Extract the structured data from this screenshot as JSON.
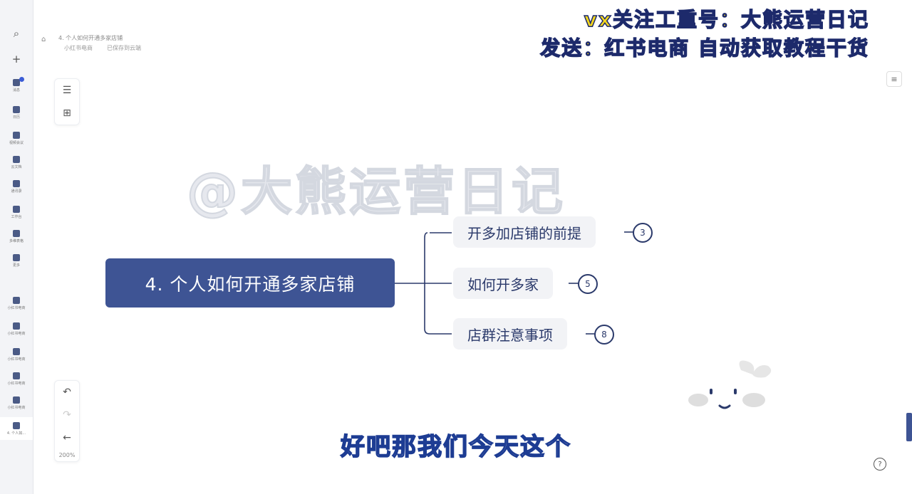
{
  "watermark": {
    "line1": "vx关注工重号：大熊运营日记",
    "line2": "发送：红书电商   自动获取教程干货",
    "center": "@大熊运营日记"
  },
  "doc": {
    "title": "4. 个人如何开通多家店铺",
    "meta1": "小红书电商",
    "meta2": "已保存到云端"
  },
  "sidebar": {
    "items": [
      {
        "label": "消息",
        "icon": "message-icon"
      },
      {
        "label": "日历",
        "icon": "calendar-icon"
      },
      {
        "label": "视频会议",
        "icon": "video-icon"
      },
      {
        "label": "云文档",
        "icon": "doc-icon"
      },
      {
        "label": "通讯录",
        "icon": "contacts-icon"
      },
      {
        "label": "工作台",
        "icon": "apps-icon"
      },
      {
        "label": "多维表格",
        "icon": "table-icon"
      },
      {
        "label": "更多",
        "icon": "more-icon"
      },
      {
        "label": "小红书电商",
        "icon": "doc-icon"
      },
      {
        "label": "小红书电商",
        "icon": "doc-icon"
      },
      {
        "label": "小红书电商",
        "icon": "doc-icon"
      },
      {
        "label": "小红书电商",
        "icon": "doc-icon"
      },
      {
        "label": "小红书电商",
        "icon": "doc-icon"
      },
      {
        "label": "4. 个人如...",
        "icon": "doc-icon"
      }
    ]
  },
  "mindmap": {
    "root": "4. 个人如何开通多家店铺",
    "children": [
      {
        "label": "开多加店铺的前提",
        "count": "3"
      },
      {
        "label": "如何开多家",
        "count": "5"
      },
      {
        "label": "店群注意事项",
        "count": "8"
      }
    ],
    "colors": {
      "root": "#3e5494",
      "child_bg": "#f2f3f6",
      "line": "#2b3a6b"
    }
  },
  "toolbar": {
    "zoom": "200%"
  },
  "subtitle": "好吧那我们今天这个"
}
